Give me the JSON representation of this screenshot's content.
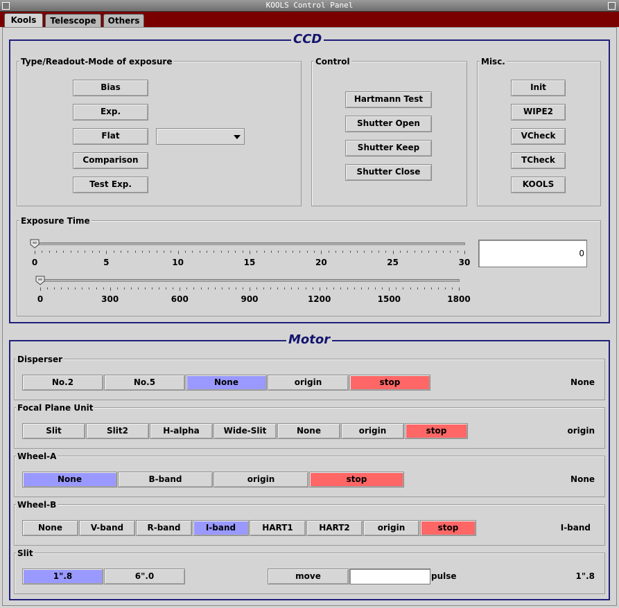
{
  "window": {
    "title": "KOOLS Control Panel"
  },
  "tabs": [
    "Kools",
    "Telescope",
    "Others"
  ],
  "ccd": {
    "title": "CCD",
    "type_group": {
      "label": "Type/Readout-Mode of exposure",
      "buttons": [
        "Bias",
        "Exp.",
        "Flat",
        "Comparison",
        "Test Exp."
      ],
      "flat_select_value": ""
    },
    "control_group": {
      "label": "Control",
      "buttons": [
        "Hartmann Test",
        "Shutter Open",
        "Shutter Keep",
        "Shutter Close"
      ]
    },
    "misc_group": {
      "label": "Misc.",
      "buttons": [
        "Init",
        "WIPE2",
        "VCheck",
        "TCheck",
        "KOOLS"
      ]
    },
    "exposure": {
      "label": "Exposure Time",
      "slider1": {
        "min": 0,
        "max": 30,
        "value": 0,
        "labels": [
          "0",
          "5",
          "10",
          "15",
          "20",
          "25",
          "30"
        ]
      },
      "slider2": {
        "min": 0,
        "max": 1800,
        "value": 0,
        "labels": [
          "0",
          "300",
          "600",
          "900",
          "1200",
          "1500",
          "1800"
        ]
      },
      "value_field": "0"
    }
  },
  "motor": {
    "title": "Motor",
    "disperser": {
      "label": "Disperser",
      "buttons": [
        "No.2",
        "No.5",
        "None",
        "origin",
        "stop"
      ],
      "selected": "None",
      "status": "None"
    },
    "fpu": {
      "label": "Focal Plane Unit",
      "buttons": [
        "Slit",
        "Slit2",
        "H-alpha",
        "Wide-Slit",
        "None",
        "origin",
        "stop"
      ],
      "status": "origin"
    },
    "wheel_a": {
      "label": "Wheel-A",
      "buttons": [
        "None",
        "B-band",
        "origin",
        "stop"
      ],
      "selected": "None",
      "status": "None"
    },
    "wheel_b": {
      "label": "Wheel-B",
      "buttons": [
        "None",
        "V-band",
        "R-band",
        "I-band",
        "HART1",
        "HART2",
        "origin",
        "stop"
      ],
      "selected": "I-band",
      "status": "I-band"
    },
    "slit": {
      "label": "Slit",
      "buttons": [
        "1\".8",
        "6\".0"
      ],
      "selected": "1\".8",
      "move_label": "move",
      "pulse_value": "",
      "pulse_label": "pulse",
      "status": "1\".8"
    }
  },
  "colors": {
    "selected": "#9999ff",
    "stop": "#ff6666",
    "tabbar": "#7a0000",
    "title_border": "#1f1f7a"
  }
}
